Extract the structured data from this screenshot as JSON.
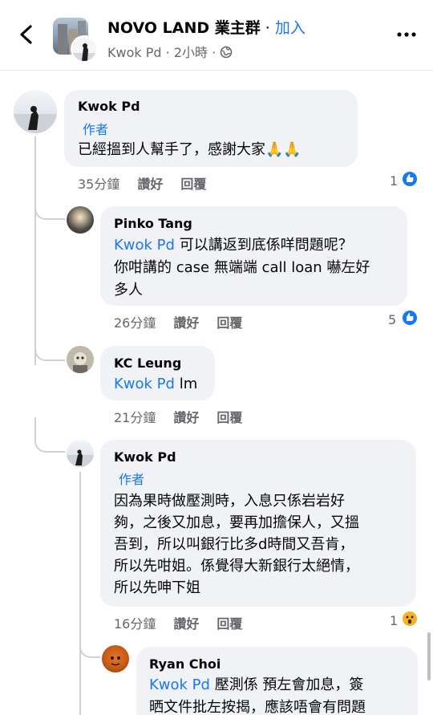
{
  "header": {
    "group_name": "NOVO LAND 業主群",
    "separator": "·",
    "join_label": "加入",
    "poster": "Kwok Pd",
    "time": "2小時",
    "icons": [
      "back-arrow-icon",
      "globe-icon",
      "more-icon"
    ]
  },
  "comments": [
    {
      "name": "Kwok Pd",
      "badge": "作者",
      "lines": [
        "已經搵到人幫手了，感謝大家🙏🙏"
      ],
      "time": "35分鐘",
      "like": "讚好",
      "reply": "回覆",
      "reaction_count": "1",
      "reaction": "like"
    },
    {
      "name": "Pinko Tang",
      "mention": "Kwok Pd",
      "lines": [
        "可以講返到底係咩問題呢？",
        "你咁講的 case 無端端 call loan 嚇左好",
        "多人"
      ],
      "time": "26分鐘",
      "like": "讚好",
      "reply": "回覆",
      "reaction_count": "5",
      "reaction": "like"
    },
    {
      "name": "KC Leung",
      "mention": "Kwok Pd",
      "lines": [
        "lm"
      ],
      "time": "21分鐘",
      "like": "讚好",
      "reply": "回覆"
    },
    {
      "name": "Kwok Pd",
      "badge": "作者",
      "lines": [
        "因為果時做壓測時，入息只係岩岩好",
        "夠，之後又加息，要再加擔保人，又搵",
        "吾到，所以叫銀行比多d時間又吾肯，",
        "所以先咁姐。係覺得大新銀行太絕情，",
        "所以先呻下姐"
      ],
      "time": "16分鐘",
      "like": "讚好",
      "reply": "回覆",
      "reaction_count": "1",
      "reaction": "wow"
    },
    {
      "name": "Ryan Choi",
      "mention": "Kwok Pd",
      "lines": [
        "壓測係 預左會加息，簽",
        "晒文件批左按揭，應該唔會有問題"
      ]
    }
  ],
  "colors": {
    "accent": "#1877f2",
    "bubble": "#f0f2f5",
    "meta_text": "#65676b"
  }
}
